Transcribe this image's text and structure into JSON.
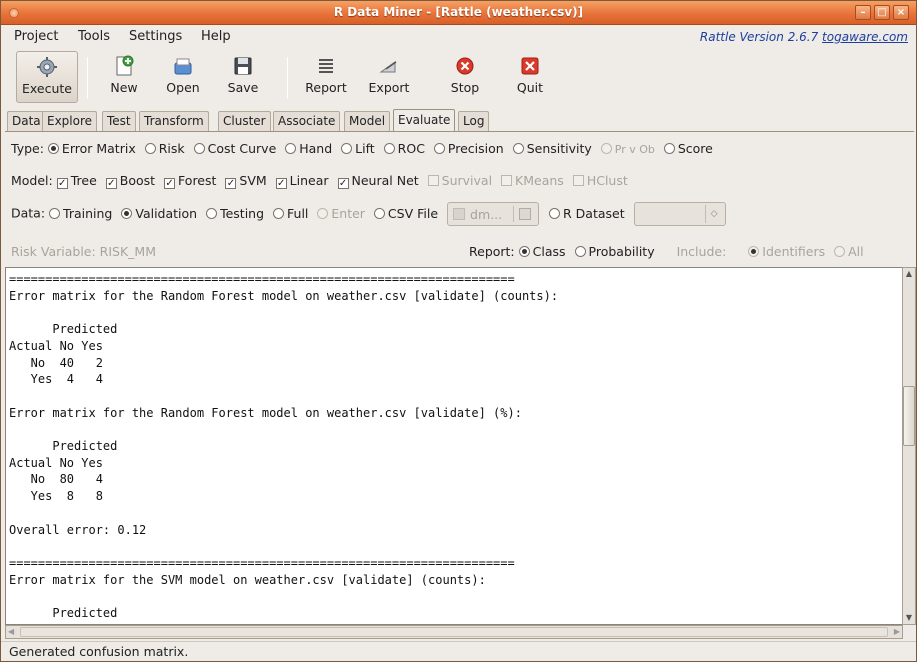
{
  "window": {
    "title": "R Data Miner - [Rattle (weather.csv)]"
  },
  "menu": {
    "items": [
      "Project",
      "Tools",
      "Settings",
      "Help"
    ],
    "version_prefix": "Rattle Version 2.6.7 ",
    "version_link": "togaware.com"
  },
  "toolbar": {
    "buttons": [
      "Execute",
      "New",
      "Open",
      "Save",
      "Report",
      "Export",
      "Stop",
      "Quit"
    ]
  },
  "tabs": [
    "Data",
    "Explore",
    "Test",
    "Transform",
    "Cluster",
    "Associate",
    "Model",
    "Evaluate",
    "Log"
  ],
  "selected_tab": "Evaluate",
  "type_row": {
    "label": "Type:",
    "options": [
      "Error Matrix",
      "Risk",
      "Cost Curve",
      "Hand",
      "Lift",
      "ROC",
      "Precision",
      "Sensitivity",
      "Pr v Ob",
      "Score"
    ],
    "selected": "Error Matrix"
  },
  "model_row": {
    "label": "Model:",
    "options": [
      "Tree",
      "Boost",
      "Forest",
      "SVM",
      "Linear",
      "Neural Net",
      "Survival",
      "KMeans",
      "HClust"
    ],
    "checked": [
      "Tree",
      "Boost",
      "Forest",
      "SVM",
      "Linear",
      "Neural Net"
    ]
  },
  "data_row": {
    "label": "Data:",
    "options": [
      "Training",
      "Validation",
      "Testing",
      "Full",
      "Enter",
      "CSV File"
    ],
    "selected": "Validation",
    "csv_value": "dm...",
    "rdataset_label": "R Dataset",
    "rdataset_value": ""
  },
  "risk_row": {
    "risk_label": "Risk Variable: RISK_MM",
    "report_label": "Report:",
    "report_options": [
      "Class",
      "Probability"
    ],
    "report_selected": "Class",
    "include_label": "Include:",
    "include_options": [
      "Identifiers",
      "All"
    ],
    "include_selected": "Identifiers"
  },
  "output": {
    "text": "======================================================================\nError matrix for the Random Forest model on weather.csv [validate] (counts):\n\n      Predicted\nActual No Yes\n   No  40   2\n   Yes  4   4\n\nError matrix for the Random Forest model on weather.csv [validate] (%):\n\n      Predicted\nActual No Yes\n   No  80   4\n   Yes  8   8\n\nOverall error: 0.12\n\n======================================================================\nError matrix for the SVM model on weather.csv [validate] (counts):\n\n      Predicted"
  },
  "status": {
    "text": "Generated confusion matrix."
  }
}
